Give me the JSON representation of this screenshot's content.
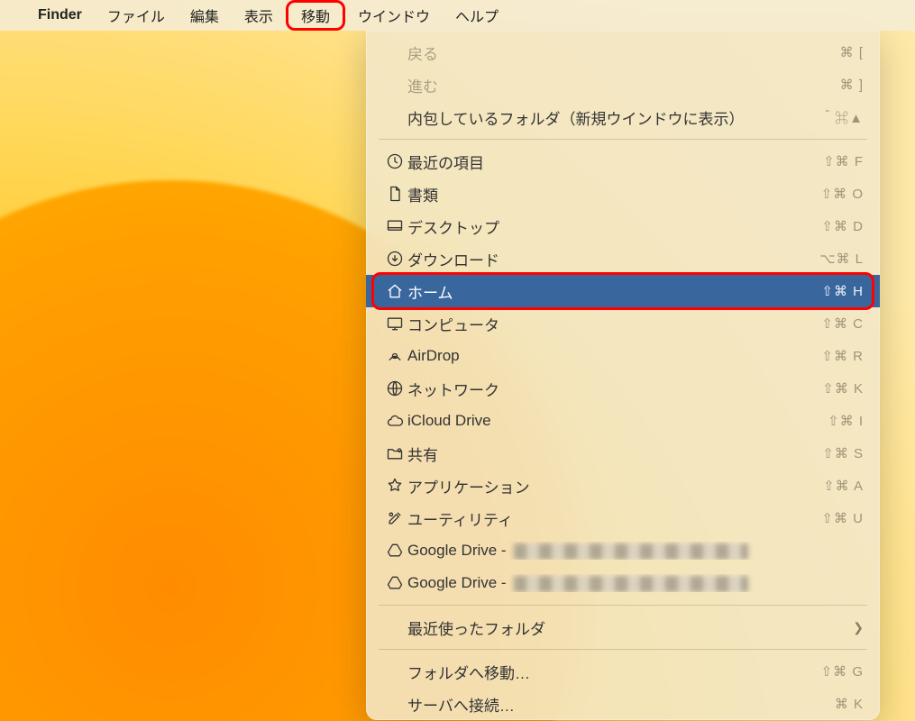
{
  "menubar": {
    "app": "Finder",
    "items": [
      "ファイル",
      "編集",
      "表示",
      "移動",
      "ウインドウ",
      "ヘルプ"
    ]
  },
  "menu": {
    "back": {
      "label": "戻る",
      "short": "⌘ ["
    },
    "forward": {
      "label": "進む",
      "short": "⌘ ]"
    },
    "enclosing": {
      "label": "内包しているフォルダ（新規ウインドウに表示）",
      "short": "＾⌘▲"
    },
    "recents": {
      "label": "最近の項目",
      "short": "⇧⌘ F"
    },
    "documents": {
      "label": "書類",
      "short": "⇧⌘ O"
    },
    "desktop": {
      "label": "デスクトップ",
      "short": "⇧⌘ D"
    },
    "downloads": {
      "label": "ダウンロード",
      "short": "⌥⌘ L"
    },
    "home": {
      "label": "ホーム",
      "short": "⇧⌘ H"
    },
    "computer": {
      "label": "コンピュータ",
      "short": "⇧⌘ C"
    },
    "airdrop": {
      "label": "AirDrop",
      "short": "⇧⌘ R"
    },
    "network": {
      "label": "ネットワーク",
      "short": "⇧⌘ K"
    },
    "icloud": {
      "label": "iCloud Drive",
      "short": "⇧⌘ I"
    },
    "shared": {
      "label": "共有",
      "short": "⇧⌘ S"
    },
    "applications": {
      "label": "アプリケーション",
      "short": "⇧⌘ A"
    },
    "utilities": {
      "label": "ユーティリティ",
      "short": "⇧⌘ U"
    },
    "gdrive1": {
      "label": "Google Drive - "
    },
    "gdrive2": {
      "label": "Google Drive - "
    },
    "recentFolders": {
      "label": "最近使ったフォルダ"
    },
    "goToFolder": {
      "label": "フォルダへ移動…",
      "short": "⇧⌘ G"
    },
    "connect": {
      "label": "サーバへ接続…",
      "short": "⌘ K"
    }
  }
}
